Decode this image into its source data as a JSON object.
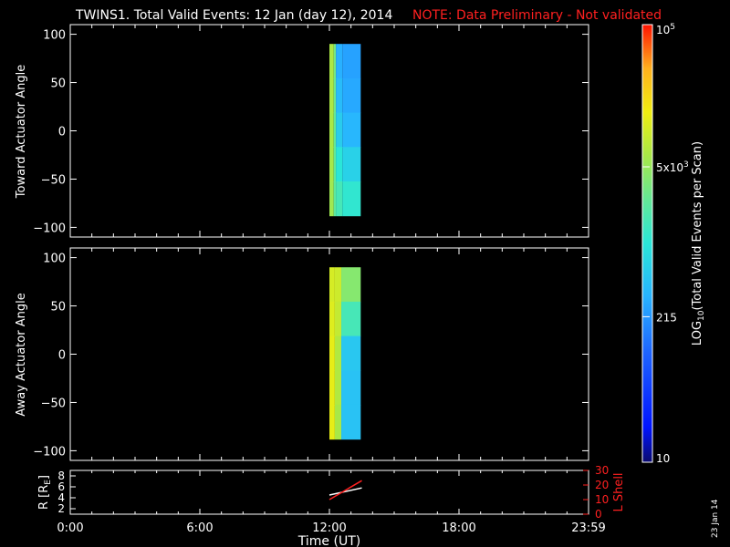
{
  "title": {
    "main": "TWINS1. Total Valid Events: 12 Jan (day  12), 2014",
    "note": "NOTE: Data Preliminary - Not validated",
    "note_color": "#ff2020"
  },
  "side_date": "23 Jan 14",
  "chart_data": [
    {
      "type": "heatmap",
      "ylabel": "Toward Actuator Angle",
      "ylim": [
        -110,
        110
      ],
      "yticks": [
        "100",
        "50",
        "0",
        "−50",
        "−100"
      ],
      "ytick_values": [
        100,
        50,
        0,
        -50,
        -100
      ],
      "xlim_hours": [
        0,
        24
      ],
      "data_span": {
        "t_start": 12.0,
        "t_end": 13.45,
        "angle_min": -88,
        "angle_max": 90
      },
      "columns": [
        {
          "t0": 12.0,
          "t1": 12.2,
          "log10_values": [
            3.82,
            3.82,
            3.8,
            3.78,
            3.75
          ]
        },
        {
          "t0": 12.2,
          "t1": 12.3,
          "log10_values": [
            3.5,
            3.45,
            3.4,
            3.38,
            3.35
          ]
        },
        {
          "t0": 12.3,
          "t1": 12.6,
          "log10_values": [
            2.5,
            2.6,
            2.75,
            3.0,
            3.2
          ]
        },
        {
          "t0": 12.6,
          "t1": 13.45,
          "log10_values": [
            2.4,
            2.45,
            2.55,
            2.8,
            3.05
          ]
        }
      ]
    },
    {
      "type": "heatmap",
      "ylabel": "Away Actuator Angle",
      "ylim": [
        -110,
        110
      ],
      "yticks": [
        "100",
        "50",
        "0",
        "−50",
        "−100"
      ],
      "ytick_values": [
        100,
        50,
        0,
        -50,
        -100
      ],
      "xlim_hours": [
        0,
        24
      ],
      "data_span": {
        "t_start": 12.0,
        "t_end": 13.45,
        "angle_min": -88,
        "angle_max": 90
      },
      "columns": [
        {
          "t0": 12.0,
          "t1": 12.25,
          "log10_values": [
            4.05,
            4.1,
            4.15,
            4.15,
            4.15
          ]
        },
        {
          "t0": 12.25,
          "t1": 12.55,
          "log10_values": [
            4.0,
            3.95,
            3.85,
            3.85,
            3.8
          ]
        },
        {
          "t0": 12.55,
          "t1": 13.45,
          "log10_values": [
            3.6,
            3.2,
            2.7,
            2.65,
            2.65
          ]
        }
      ]
    },
    {
      "type": "line",
      "ylabel": "R [R",
      "ylabel_sub": "E",
      "ylim": [
        1,
        9
      ],
      "yticks": [
        "8",
        "6",
        "4",
        "2"
      ],
      "ytick_values": [
        8,
        6,
        4,
        2
      ],
      "y2label": "L Shell",
      "y2lim": [
        0,
        30
      ],
      "y2ticks": [
        "30",
        "20",
        "10",
        "0"
      ],
      "y2tick_values": [
        30,
        20,
        10,
        0
      ],
      "xlabel": "Time (UT)",
      "xticks": [
        "0:00",
        "6:00",
        "12:00",
        "18:00",
        "23:59"
      ],
      "xtick_hours": [
        0,
        6,
        12,
        18,
        24
      ],
      "series": [
        {
          "axis": "left",
          "color": "#ffffff",
          "x": [
            12.0,
            13.5
          ],
          "y": [
            4.5,
            5.8
          ]
        },
        {
          "axis": "right",
          "color": "#ff2020",
          "x": [
            12.0,
            13.5
          ],
          "y": [
            10,
            23
          ]
        }
      ]
    }
  ],
  "colorbar": {
    "label_main": "LOG",
    "label_sub": "10",
    "label_rest": "(Total Valid Events per Scan)",
    "tick_labels": [
      "10",
      "215",
      "5x10",
      "10"
    ],
    "tick_sups": [
      "",
      "",
      "3",
      "5"
    ],
    "tick_values": [
      1.0,
      2.33,
      3.7,
      5.0
    ],
    "range": [
      1,
      5
    ]
  }
}
